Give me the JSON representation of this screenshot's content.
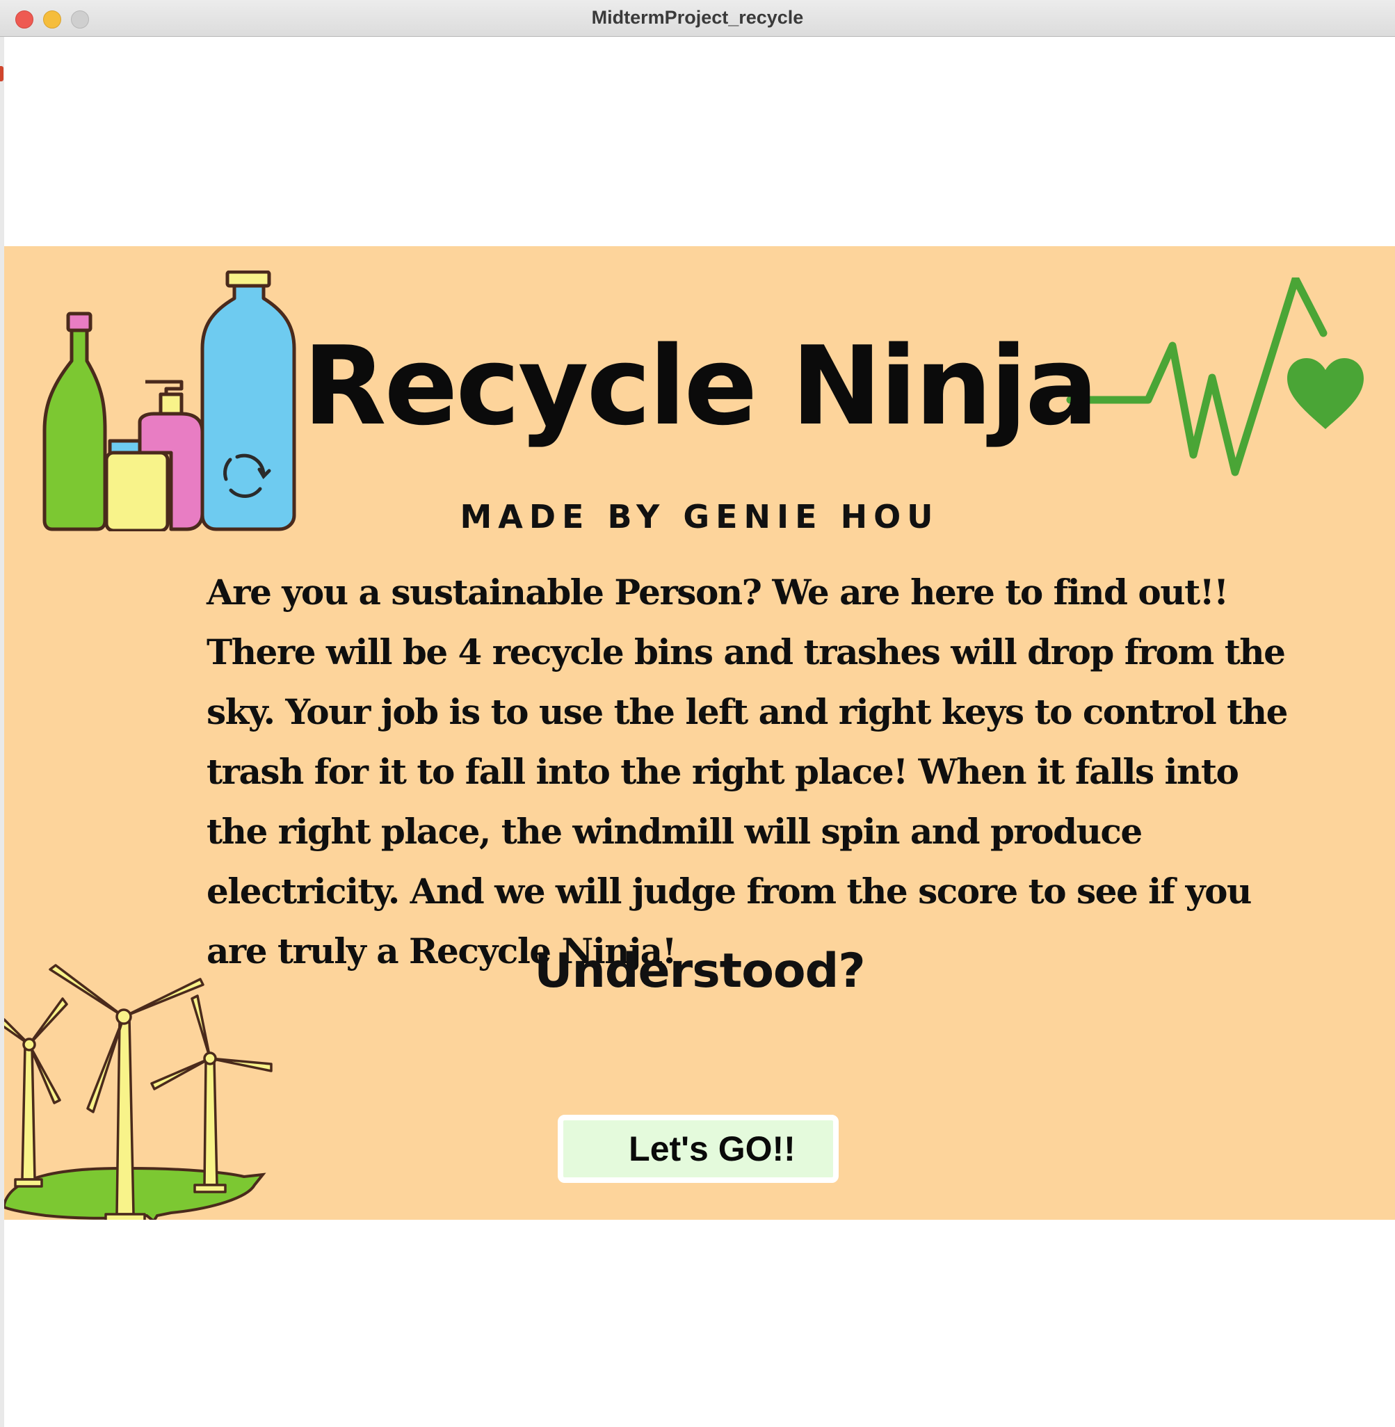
{
  "window": {
    "title": "MidtermProject_recycle"
  },
  "game": {
    "title": "Recycle Ninja",
    "subtitle": "MADE BY GENIE HOU",
    "instructions": "Are you a sustainable Person? We are here to find out!! There will be 4 recycle bins and trashes will drop from the sky. Your job is to use the left and right keys to control the trash for it to fall into the right place! When it falls into the right place, the windmill will spin and produce electricity. And we will judge from the score to see if you are truly a Recycle Ninja!",
    "question": "Understood?",
    "start_button_label": "Let's GO!!"
  },
  "colors": {
    "panel_background": "#fdd49b",
    "button_background": "#e4fadc",
    "heartbeat_green": "#4aa536",
    "bottle_green": "#7cc832",
    "bottle_yellow": "#f8f38a",
    "bottle_pink": "#e87dc3",
    "bottle_blue": "#6ecbf0"
  },
  "icons": {
    "bottles": "recycle-bottles-icon",
    "heartbeat": "heartbeat-heart-icon",
    "windmills": "windmills-icon",
    "recycle": "recycle-icon"
  }
}
